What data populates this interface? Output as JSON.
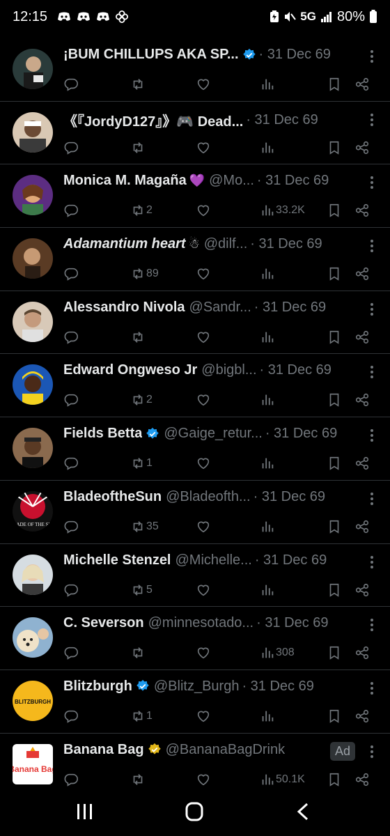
{
  "status_bar": {
    "time": "12:15",
    "network": "5G",
    "battery": "80%"
  },
  "colors": {
    "verified_blue": "#1d9bf0",
    "verified_gold": "#e2b719",
    "icon_gray": "#71767b",
    "separator": "#2f3336"
  },
  "posts": [
    {
      "name": "¡BUM CHILLUPS AKA SP...",
      "verified": "blue",
      "handle": "",
      "date": "· 31 Dec 69",
      "counts": {
        "retweets": "",
        "views": ""
      },
      "avatar": "avatar-1"
    },
    {
      "name": "《『JordyD127』》🎮 Dead...",
      "verified": "",
      "handle": "",
      "date": "· 31 Dec 69",
      "counts": {
        "retweets": "",
        "views": ""
      },
      "avatar": "avatar-2"
    },
    {
      "name": "Monica M. Magaña",
      "emoji": "💜",
      "verified": "",
      "handle": "@Mo...",
      "date": "· 31 Dec 69",
      "counts": {
        "retweets": "2",
        "views": "33.2K"
      },
      "avatar": "avatar-3"
    },
    {
      "name": "Adamantium heart",
      "emoji": "☃",
      "verified": "",
      "handle": "@dilf...",
      "date": "· 31 Dec 69",
      "counts": {
        "retweets": "89",
        "views": ""
      },
      "avatar": "avatar-4",
      "italic": true
    },
    {
      "name": "Alessandro Nivola",
      "verified": "",
      "handle": "@Sandr...",
      "date": "· 31 Dec 69",
      "counts": {
        "retweets": "",
        "views": ""
      },
      "avatar": "avatar-5"
    },
    {
      "name": "Edward Ongweso Jr",
      "verified": "",
      "handle": "@bigbl...",
      "date": "· 31 Dec 69",
      "counts": {
        "retweets": "2",
        "views": ""
      },
      "avatar": "avatar-6"
    },
    {
      "name": "Fields Betta",
      "verified": "blue",
      "handle": "@Gaige_retur...",
      "date": "· 31 Dec 69",
      "counts": {
        "retweets": "1",
        "views": ""
      },
      "avatar": "avatar-7"
    },
    {
      "name": "BladeoftheSun",
      "verified": "",
      "handle": "@Bladeofth...",
      "date": "· 31 Dec 69",
      "counts": {
        "retweets": "35",
        "views": ""
      },
      "avatar": "avatar-8"
    },
    {
      "name": "Michelle Stenzel",
      "verified": "",
      "handle": "@Michelle...",
      "date": "· 31 Dec 69",
      "counts": {
        "retweets": "5",
        "views": ""
      },
      "avatar": "avatar-9"
    },
    {
      "name": "C. Severson",
      "verified": "",
      "handle": "@minnesotado...",
      "date": "· 31 Dec 69",
      "counts": {
        "retweets": "",
        "views": "308"
      },
      "avatar": "avatar-10"
    },
    {
      "name": "Blitzburgh",
      "verified": "blue",
      "handle": "@Blitz_Burgh",
      "date": "· 31 Dec 69",
      "counts": {
        "retweets": "1",
        "views": ""
      },
      "avatar": "avatar-11"
    },
    {
      "name": "Banana Bag",
      "verified": "gold",
      "handle": "@BananaBagDrink",
      "date": "",
      "ad": "Ad",
      "counts": {
        "retweets": "",
        "views": "50.1K"
      },
      "avatar": "avatar-12"
    }
  ],
  "avatar_text": {
    "avatar-8": "BLADE OF THE SUN",
    "avatar-11": "BLITZBURGH",
    "avatar-12": "Banana Bag"
  }
}
